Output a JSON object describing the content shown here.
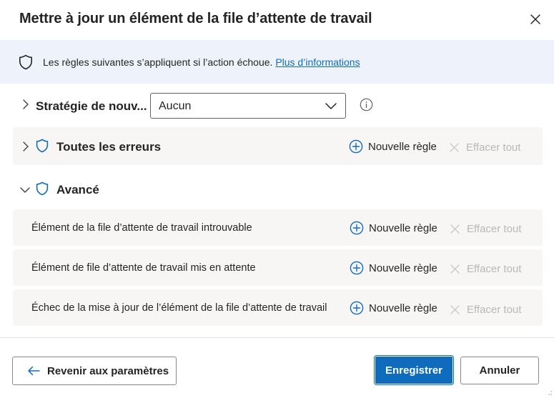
{
  "dialog": {
    "title": "Mettre à jour un élément de la file d’attente de travail",
    "close_icon": "close-icon"
  },
  "banner": {
    "icon": "shield-icon",
    "text": "Les règles suivantes s’appliquent si l’action échoue. ",
    "link": "Plus d’informations"
  },
  "strategy": {
    "label": "Stratégie de nouv...",
    "selected": "Aucun",
    "info_icon": "info-icon"
  },
  "groups": {
    "all_errors": {
      "label": "Toutes les erreurs",
      "new_rule": "Nouvelle règle",
      "clear_all": "Effacer tout"
    },
    "advanced": {
      "label": "Avancé",
      "items": [
        {
          "label": "Élément de la file d’attente de travail introuvable",
          "new_rule": "Nouvelle règle",
          "clear_all": "Effacer tout"
        },
        {
          "label": "Élément de file d’attente de travail mis en attente",
          "new_rule": "Nouvelle règle",
          "clear_all": "Effacer tout"
        },
        {
          "label": "Échec de la mise à jour de l’élément de la file d’attente de travail",
          "new_rule": "Nouvelle règle",
          "clear_all": "Effacer tout"
        }
      ]
    }
  },
  "footer": {
    "back": "Revenir aux paramètres",
    "save": "Enregistrer",
    "cancel": "Annuler"
  },
  "colors": {
    "accent": "#0f6cbd",
    "banner_bg": "#eef3fb",
    "panel_bg": "#f7f6f5",
    "disabled_text": "#b8b8b8"
  }
}
